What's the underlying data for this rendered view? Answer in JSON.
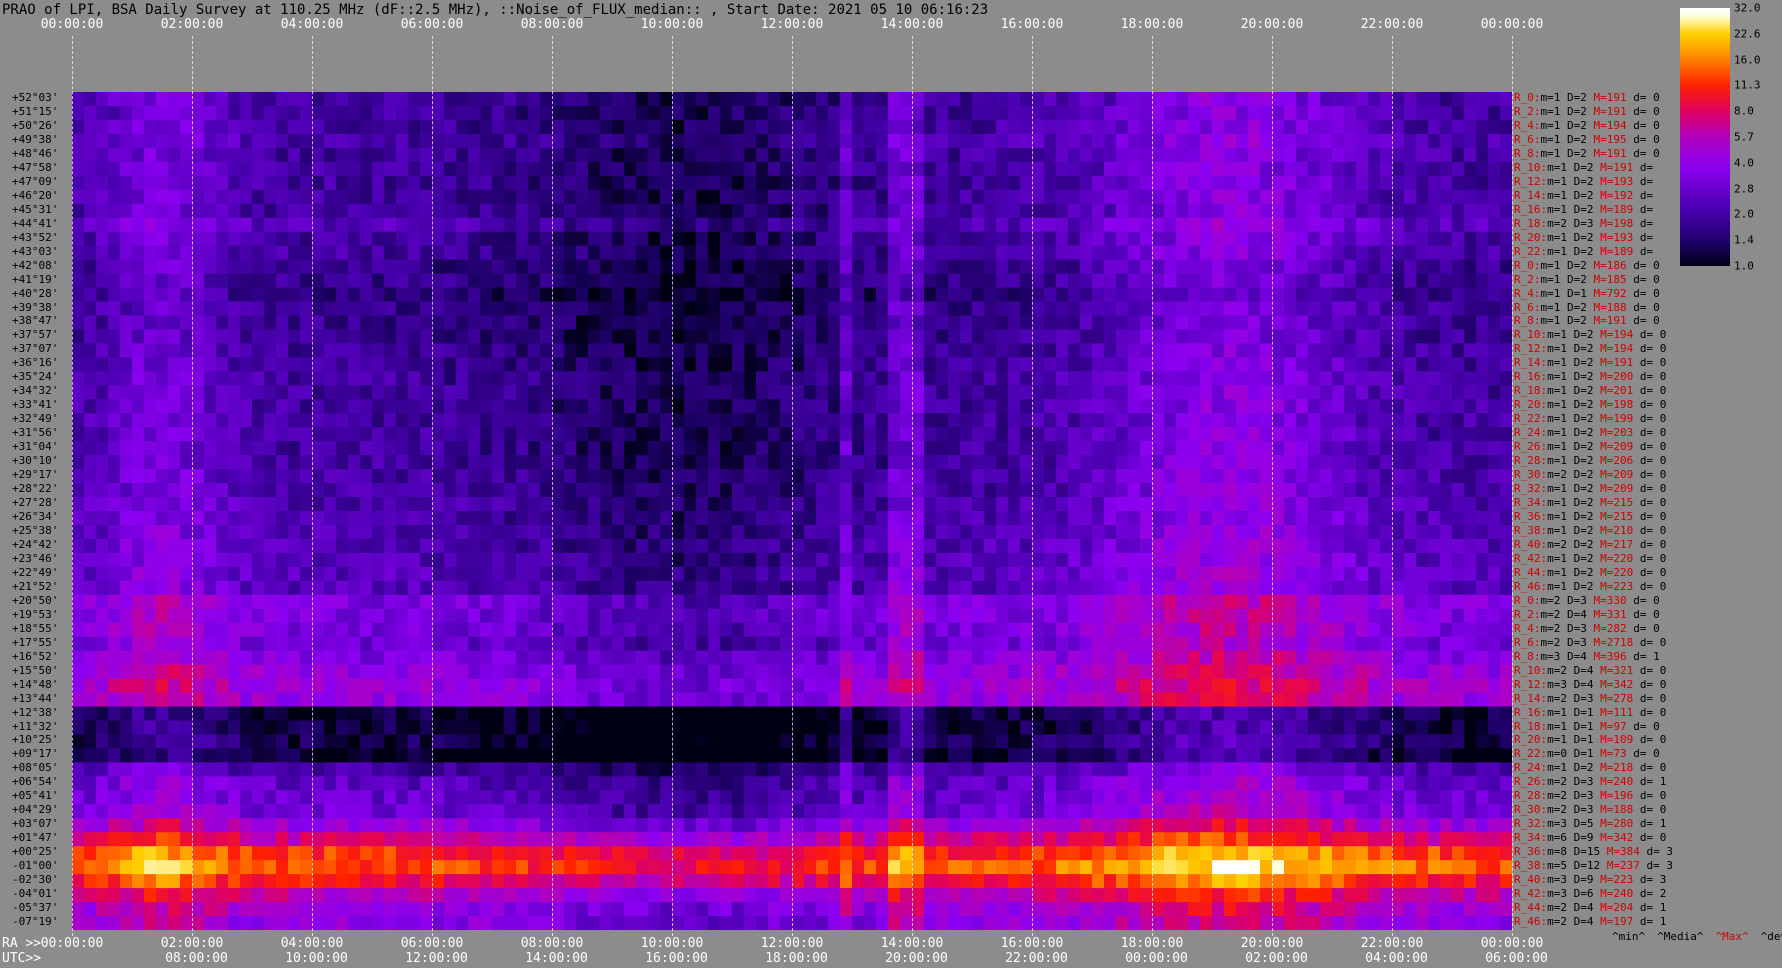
{
  "title": "PRAO of LPI, BSA Daily Survey at 110.25 MHz (dF::2.5 MHz), ::Noise_of_FLUX_median:: , Start Date: 2021 05 10 06:16:23",
  "ra_top_ticks": [
    "00:00:00",
    "02:00:00",
    "04:00:00",
    "06:00:00",
    "08:00:00",
    "10:00:00",
    "12:00:00",
    "14:00:00",
    "16:00:00",
    "18:00:00",
    "20:00:00",
    "22:00:00",
    "00:00:00"
  ],
  "bottom": {
    "ra_label": "RA >>",
    "utc_label": "UTC>>",
    "ra_ticks": [
      "00:00:00",
      "02:00:00",
      "04:00:00",
      "06:00:00",
      "08:00:00",
      "10:00:00",
      "12:00:00",
      "14:00:00",
      "16:00:00",
      "18:00:00",
      "20:00:00",
      "22:00:00",
      "00:00:00"
    ],
    "utc_ticks": [
      "08:00:00",
      "10:00:00",
      "12:00:00",
      "14:00:00",
      "16:00:00",
      "18:00:00",
      "20:00:00",
      "22:00:00",
      "00:00:00",
      "02:00:00",
      "04:00:00",
      "06:00:00"
    ]
  },
  "legend_stats": {
    "min": "^min^",
    "median": "^Media^",
    "max": "^Max^",
    "devia": "^devia^"
  },
  "colorbar": {
    "ticks": [
      "32.0",
      "22.6",
      "16.0",
      "11.3",
      "8.0",
      "5.7",
      "4.0",
      "2.8",
      "2.0",
      "1.4",
      "1.0"
    ]
  },
  "chart_data": {
    "type": "heatmap",
    "title": "PRAO of LPI, BSA Daily Survey at 110.25 MHz (dF::2.5 MHz), ::Noise_of_FLUX_median:: , Start Date: 2021 05 10 06:16:23",
    "x_axis_top": "RA",
    "x_axis_bottom": "UTC",
    "colorscale_range": [
      1.0,
      32.0
    ],
    "colorscale_log": true,
    "declinations": [
      "+52°03'",
      "+51°15'",
      "+50°26'",
      "+49°38'",
      "+48°46'",
      "+47°58'",
      "+47°09'",
      "+46°20'",
      "+45°31'",
      "+44°41'",
      "+43°52'",
      "+43°03'",
      "+42°08'",
      "+41°19'",
      "+40°28'",
      "+39°38'",
      "+38°47'",
      "+37°57'",
      "+37°07'",
      "+36°16'",
      "+35°24'",
      "+34°32'",
      "+33°41'",
      "+32°49'",
      "+31°56'",
      "+31°04'",
      "+30°10'",
      "+29°17'",
      "+28°22'",
      "+27°28'",
      "+26°34'",
      "+25°38'",
      "+24°42'",
      "+23°46'",
      "+22°49'",
      "+21°52'",
      "+20°50'",
      "+19°53'",
      "+18°55'",
      "+17°55'",
      "+16°52'",
      "+15°50'",
      "+14°48'",
      "+13°44'",
      "+12°38'",
      "+11°32'",
      "+10°25'",
      "+09°17'",
      "+08°05'",
      "+06°54'",
      "+05°41'",
      "+04°29'",
      "+03°07'",
      "+01°47'",
      "+00°25'",
      "-01°00'",
      "-02°30'",
      "-04°01'",
      "-05°37'",
      "-07°19'"
    ],
    "row_stats": [
      {
        "r": "R_0:",
        "m": "m=1",
        "d": "D=2",
        "M": "M=191",
        "dv": "d= 0"
      },
      {
        "r": "R_2:",
        "m": "m=1",
        "d": "D=2",
        "M": "M=191",
        "dv": "d= 0"
      },
      {
        "r": "R_4:",
        "m": "m=1",
        "d": "D=2",
        "M": "M=194",
        "dv": "d= 0"
      },
      {
        "r": "R_6:",
        "m": "m=1",
        "d": "D=2",
        "M": "M=195",
        "dv": "d= 0"
      },
      {
        "r": "R_8:",
        "m": "m=1",
        "d": "D=2",
        "M": "M=191",
        "dv": "d= 0"
      },
      {
        "r": "R_10:",
        "m": "m=1",
        "d": "D=2",
        "M": "M=191",
        "dv": "d="
      },
      {
        "r": "R_12:",
        "m": "m=1",
        "d": "D=2",
        "M": "M=193",
        "dv": "d="
      },
      {
        "r": "R_14:",
        "m": "m=1",
        "d": "D=2",
        "M": "M=192",
        "dv": "d="
      },
      {
        "r": "R_16:",
        "m": "m=1",
        "d": "D=2",
        "M": "M=189",
        "dv": "d="
      },
      {
        "r": "R_18:",
        "m": "m=2",
        "d": "D=3",
        "M": "M=198",
        "dv": "d="
      },
      {
        "r": "R_20:",
        "m": "m=1",
        "d": "D=2",
        "M": "M=193",
        "dv": "d="
      },
      {
        "r": "R_22:",
        "m": "m=1",
        "d": "D=2",
        "M": "M=189",
        "dv": "d="
      },
      {
        "r": "R_0:",
        "m": "m=1",
        "d": "D=2",
        "M": "M=186",
        "dv": "d= 0"
      },
      {
        "r": "R_2:",
        "m": "m=1",
        "d": "D=2",
        "M": "M=185",
        "dv": "d= 0"
      },
      {
        "r": "R_4:",
        "m": "m=1",
        "d": "D=1",
        "M": "M=792",
        "dv": "d= 0"
      },
      {
        "r": "R_6:",
        "m": "m=1",
        "d": "D=2",
        "M": "M=188",
        "dv": "d= 0"
      },
      {
        "r": "R_8:",
        "m": "m=1",
        "d": "D=2",
        "M": "M=191",
        "dv": "d= 0"
      },
      {
        "r": "R_10:",
        "m": "m=1",
        "d": "D=2",
        "M": "M=194",
        "dv": "d= 0"
      },
      {
        "r": "R_12:",
        "m": "m=1",
        "d": "D=2",
        "M": "M=194",
        "dv": "d= 0"
      },
      {
        "r": "R_14:",
        "m": "m=1",
        "d": "D=2",
        "M": "M=191",
        "dv": "d= 0"
      },
      {
        "r": "R_16:",
        "m": "m=1",
        "d": "D=2",
        "M": "M=200",
        "dv": "d= 0"
      },
      {
        "r": "R_18:",
        "m": "m=1",
        "d": "D=2",
        "M": "M=201",
        "dv": "d= 0"
      },
      {
        "r": "R_20:",
        "m": "m=1",
        "d": "D=2",
        "M": "M=198",
        "dv": "d= 0"
      },
      {
        "r": "R_22:",
        "m": "m=1",
        "d": "D=2",
        "M": "M=199",
        "dv": "d= 0"
      },
      {
        "r": "R_24:",
        "m": "m=1",
        "d": "D=2",
        "M": "M=203",
        "dv": "d= 0"
      },
      {
        "r": "R_26:",
        "m": "m=1",
        "d": "D=2",
        "M": "M=209",
        "dv": "d= 0"
      },
      {
        "r": "R_28:",
        "m": "m=1",
        "d": "D=2",
        "M": "M=206",
        "dv": "d= 0"
      },
      {
        "r": "R_30:",
        "m": "m=2",
        "d": "D=2",
        "M": "M=209",
        "dv": "d= 0"
      },
      {
        "r": "R_32:",
        "m": "m=1",
        "d": "D=2",
        "M": "M=209",
        "dv": "d= 0"
      },
      {
        "r": "R_34:",
        "m": "m=1",
        "d": "D=2",
        "M": "M=215",
        "dv": "d= 0"
      },
      {
        "r": "R_36:",
        "m": "m=1",
        "d": "D=2",
        "M": "M=215",
        "dv": "d= 0"
      },
      {
        "r": "R_38:",
        "m": "m=1",
        "d": "D=2",
        "M": "M=210",
        "dv": "d= 0"
      },
      {
        "r": "R_40:",
        "m": "m=2",
        "d": "D=2",
        "M": "M=217",
        "dv": "d= 0"
      },
      {
        "r": "R_42:",
        "m": "m=1",
        "d": "D=2",
        "M": "M=220",
        "dv": "d= 0"
      },
      {
        "r": "R_44:",
        "m": "m=1",
        "d": "D=2",
        "M": "M=220",
        "dv": "d= 0"
      },
      {
        "r": "R_46:",
        "m": "m=1",
        "d": "D=2",
        "M": "M=223",
        "dv": "d= 0"
      },
      {
        "r": "R_0:",
        "m": "m=2",
        "d": "D=3",
        "M": "M=330",
        "dv": "d= 0"
      },
      {
        "r": "R_2:",
        "m": "m=2",
        "d": "D=4",
        "M": "M=331",
        "dv": "d= 0"
      },
      {
        "r": "R_4:",
        "m": "m=2",
        "d": "D=3",
        "M": "M=282",
        "dv": "d= 0"
      },
      {
        "r": "R_6:",
        "m": "m=2",
        "d": "D=3",
        "M": "M=2718",
        "dv": "d= 0"
      },
      {
        "r": "R_8:",
        "m": "m=3",
        "d": "D=4",
        "M": "M=396",
        "dv": "d= 1"
      },
      {
        "r": "R_10:",
        "m": "m=2",
        "d": "D=4",
        "M": "M=321",
        "dv": "d= 0"
      },
      {
        "r": "R_12:",
        "m": "m=3",
        "d": "D=4",
        "M": "M=342",
        "dv": "d= 0"
      },
      {
        "r": "R_14:",
        "m": "m=2",
        "d": "D=3",
        "M": "M=278",
        "dv": "d= 0"
      },
      {
        "r": "R_16:",
        "m": "m=1",
        "d": "D=1",
        "M": "M=111",
        "dv": "d= 0"
      },
      {
        "r": "R_18:",
        "m": "m=1",
        "d": "D=1",
        "M": "M=97",
        "dv": "d= 0"
      },
      {
        "r": "R_20:",
        "m": "m=1",
        "d": "D=1",
        "M": "M=109",
        "dv": "d= 0"
      },
      {
        "r": "R_22:",
        "m": "m=0",
        "d": "D=1",
        "M": "M=73",
        "dv": "d= 0"
      },
      {
        "r": "R_24:",
        "m": "m=1",
        "d": "D=2",
        "M": "M=218",
        "dv": "d= 0"
      },
      {
        "r": "R_26:",
        "m": "m=2",
        "d": "D=3",
        "M": "M=240",
        "dv": "d= 1"
      },
      {
        "r": "R_28:",
        "m": "m=2",
        "d": "D=3",
        "M": "M=196",
        "dv": "d= 0"
      },
      {
        "r": "R_30:",
        "m": "m=2",
        "d": "D=3",
        "M": "M=188",
        "dv": "d= 0"
      },
      {
        "r": "R_32:",
        "m": "m=3",
        "d": "D=5",
        "M": "M=280",
        "dv": "d= 1"
      },
      {
        "r": "R_34:",
        "m": "m=6",
        "d": "D=9",
        "M": "M=342",
        "dv": "d= 0"
      },
      {
        "r": "R_36:",
        "m": "m=8",
        "d": "D=15",
        "M": "M=384",
        "dv": "d= 3"
      },
      {
        "r": "R_38:",
        "m": "m=5",
        "d": "D=12",
        "M": "M=237",
        "dv": "d= 3"
      },
      {
        "r": "R_40:",
        "m": "m=3",
        "d": "D=9",
        "M": "M=223",
        "dv": "d= 3"
      },
      {
        "r": "R_42:",
        "m": "m=3",
        "d": "D=6",
        "M": "M=240",
        "dv": "d= 2"
      },
      {
        "r": "R_44:",
        "m": "m=2",
        "d": "D=4",
        "M": "M=204",
        "dv": "d= 1"
      },
      {
        "r": "R_46:",
        "m": "m=2",
        "d": "D=4",
        "M": "M=197",
        "dv": "d= 1"
      }
    ],
    "row_level_median": [
      2,
      2,
      2,
      2.2,
      2,
      2,
      2,
      2,
      2,
      2.4,
      2,
      2,
      1.8,
      1.8,
      1.6,
      1.8,
      1.8,
      1.8,
      1.9,
      1.9,
      2,
      2,
      2,
      2,
      2,
      2,
      2,
      2.1,
      2.1,
      2.2,
      2.2,
      2.3,
      2.4,
      2.4,
      2.5,
      2.5,
      3.5,
      3.4,
      3.3,
      3,
      3.6,
      4.2,
      4.6,
      4.4,
      1.2,
      1.2,
      1.3,
      1.1,
      2,
      2.6,
      2.8,
      3,
      4.5,
      7,
      12,
      14,
      10,
      6,
      4.5,
      4
    ]
  }
}
